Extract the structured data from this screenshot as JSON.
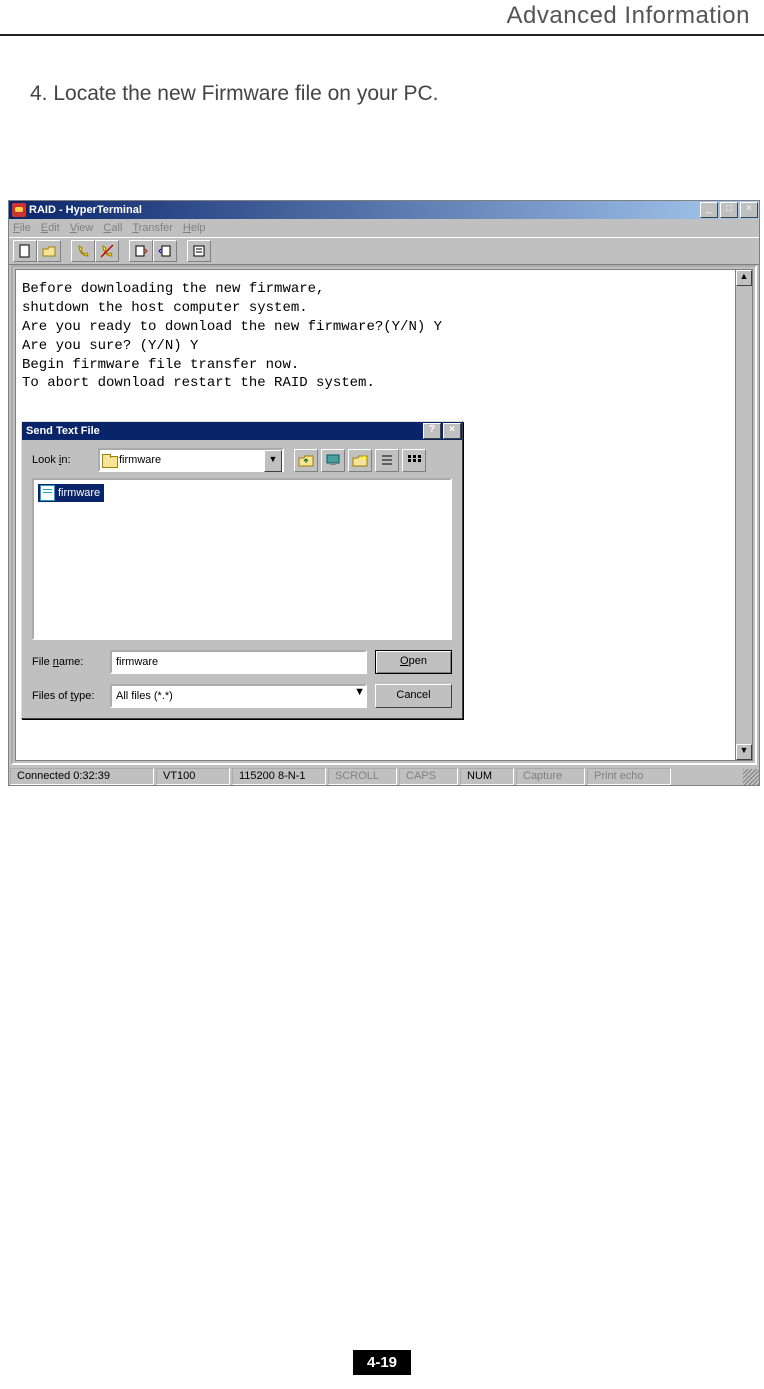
{
  "doc": {
    "section_title": "Advanced Information",
    "step_text": "4. Locate the new Firmware file on your PC.",
    "page_number": "4-19"
  },
  "app": {
    "title": "RAID - HyperTerminal",
    "menu": {
      "file": "File",
      "edit": "Edit",
      "view": "View",
      "call": "Call",
      "transfer": "Transfer",
      "help": "Help"
    },
    "terminal_lines": [
      "Before downloading the new firmware,",
      "shutdown the host computer system.",
      "Are you ready to download the new firmware?(Y/N) Y",
      "Are you sure? (Y/N) Y",
      "Begin firmware file transfer now.",
      "To abort download restart the RAID system."
    ],
    "dialog": {
      "title": "Send Text File",
      "look_in_label": "Look in:",
      "look_in_value": "firmware",
      "selected_file": "firmware",
      "file_name_label": "File name:",
      "file_name_value": "firmware",
      "files_of_type_label": "Files of type:",
      "files_of_type_value": "All files (*.*)",
      "open_button": "Open",
      "cancel_button": "Cancel"
    },
    "status": {
      "connected": "Connected 0:32:39",
      "emulation": "VT100",
      "settings": "115200 8-N-1",
      "scroll": "SCROLL",
      "caps": "CAPS",
      "num": "NUM",
      "capture": "Capture",
      "print_echo": "Print echo"
    }
  }
}
